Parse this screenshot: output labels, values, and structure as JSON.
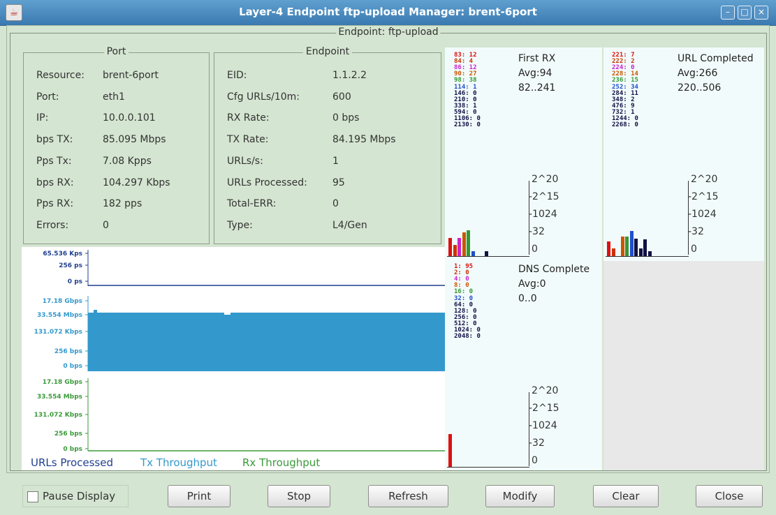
{
  "window": {
    "title": "Layer-4 Endpoint ftp-upload  Manager: brent-6port",
    "frame_label": "Endpoint: ftp-upload"
  },
  "port_panel": {
    "label": "Port",
    "rows": [
      {
        "key": "Resource:",
        "value": "brent-6port"
      },
      {
        "key": "Port:",
        "value": "eth1"
      },
      {
        "key": "IP:",
        "value": "10.0.0.101"
      },
      {
        "key": "bps TX:",
        "value": "85.095 Mbps"
      },
      {
        "key": "Pps Tx:",
        "value": "7.08 Kpps"
      },
      {
        "key": "bps RX:",
        "value": "104.297 Kbps"
      },
      {
        "key": "Pps RX:",
        "value": "182 pps"
      },
      {
        "key": "Errors:",
        "value": "0"
      }
    ]
  },
  "endpoint_panel": {
    "label": "Endpoint",
    "rows": [
      {
        "key": "EID:",
        "value": "1.1.2.2"
      },
      {
        "key": "Cfg URLs/10m:",
        "value": "600"
      },
      {
        "key": "RX Rate:",
        "value": "0 bps"
      },
      {
        "key": "TX Rate:",
        "value": "84.195 Mbps"
      },
      {
        "key": "URLs/s:",
        "value": "1"
      },
      {
        "key": "URLs Processed:",
        "value": "95"
      },
      {
        "key": "Total-ERR:",
        "value": "0"
      },
      {
        "key": "Type:",
        "value": "L4/Gen"
      }
    ]
  },
  "graph": {
    "urls_axis": [
      "65.536 Kps",
      "256 ps",
      "0 ps"
    ],
    "tx_axis": [
      "17.18 Gbps",
      "33.554 Mbps",
      "131.072 Kbps",
      "256 bps",
      "0 bps"
    ],
    "rx_axis": [
      "17.18 Gbps",
      "33.554 Mbps",
      "131.072 Kbps",
      "256 bps",
      "0 bps"
    ],
    "legend": [
      "URLs Processed",
      "Tx Throughput",
      "Rx Throughput"
    ],
    "colors": {
      "urls": "#1f3f8f",
      "tx": "#3399cc",
      "rx": "#3a9a3a"
    }
  },
  "histograms": {
    "first_rx": {
      "title": "First RX",
      "avg": "Avg:94",
      "range": "82..241",
      "buckets": [
        "83: 12",
        "84: 4",
        "86: 12",
        "90: 27",
        "98: 38",
        "114: 1",
        "146: 0",
        "210: 0",
        "338: 1",
        "594: 0",
        "1106: 0",
        "2130: 0"
      ],
      "bar_values": [
        12,
        4,
        12,
        27,
        38,
        1,
        0,
        0,
        1,
        0,
        0,
        0
      ]
    },
    "url_completed": {
      "title": "URL Completed",
      "avg": "Avg:266",
      "range": "220..506",
      "buckets": [
        "221: 7",
        "222: 2",
        "224: 0",
        "228: 14",
        "236: 15",
        "252: 34",
        "284: 11",
        "348: 2",
        "476: 9",
        "732: 1",
        "1244: 0",
        "2268: 0"
      ],
      "bar_values": [
        7,
        2,
        0,
        14,
        15,
        34,
        11,
        2,
        9,
        1,
        0,
        0
      ]
    },
    "dns_complete": {
      "title": "DNS Complete",
      "avg": "Avg:0",
      "range": "0..0",
      "buckets": [
        "1: 95",
        "2: 0",
        "4: 0",
        "8: 0",
        "16: 0",
        "32: 0",
        "64: 0",
        "128: 0",
        "256: 0",
        "512: 0",
        "1024: 0",
        "2048: 0"
      ],
      "bar_values": [
        95,
        0,
        0,
        0,
        0,
        0,
        0,
        0,
        0,
        0,
        0,
        0
      ]
    },
    "scale": [
      "2^20",
      "2^15",
      "1024",
      "32",
      "0"
    ],
    "bucket_colors": [
      "#dd1111",
      "#cc3300",
      "#cc22cc",
      "#cc5500",
      "#339933",
      "#1f4fcc",
      "#111144",
      "#111144",
      "#111144",
      "#111144",
      "#111144",
      "#111144"
    ]
  },
  "buttons": {
    "pause_display": "Pause Display",
    "print": "Print",
    "stop": "Stop",
    "refresh": "Refresh",
    "modify": "Modify",
    "clear": "Clear",
    "close": "Close"
  }
}
